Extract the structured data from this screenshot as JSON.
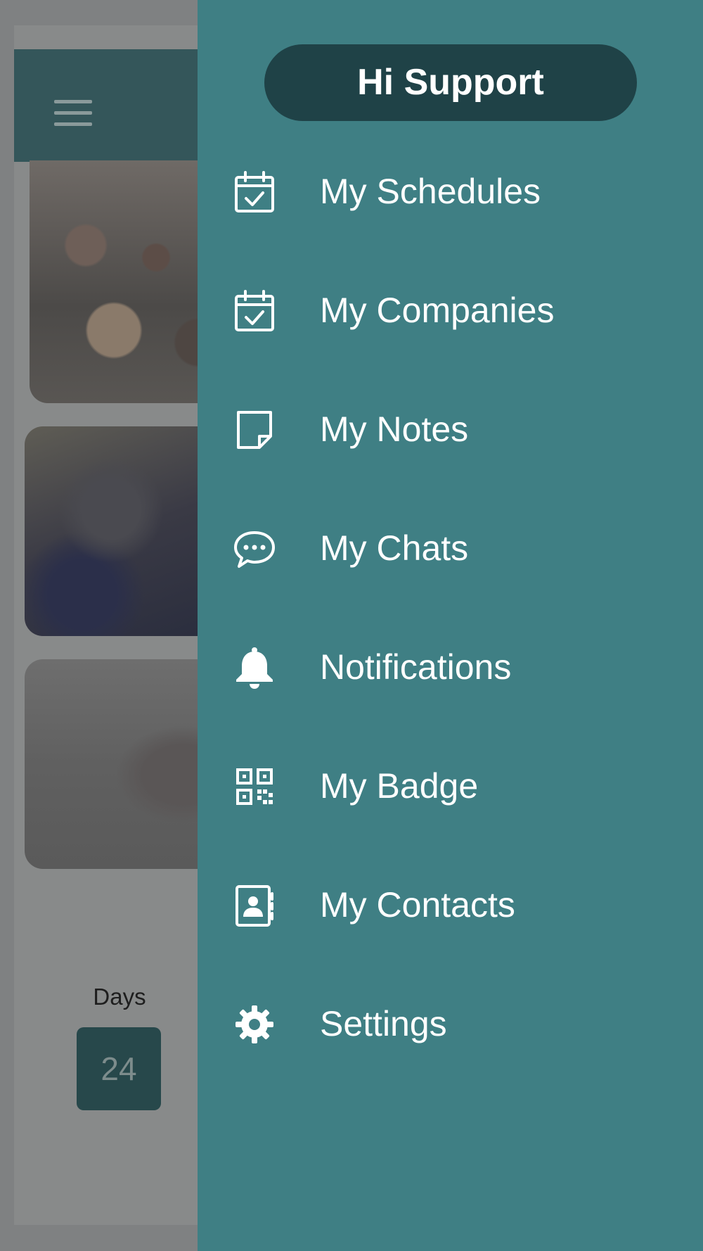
{
  "drawer": {
    "greeting": "Hi Support",
    "items": [
      {
        "label": "My Schedules",
        "icon": "calendar-check-icon"
      },
      {
        "label": "My Companies",
        "icon": "calendar-check-icon"
      },
      {
        "label": "My Notes",
        "icon": "sticky-note-icon"
      },
      {
        "label": "My Chats",
        "icon": "chat-bubble-icon"
      },
      {
        "label": "Notifications",
        "icon": "bell-icon"
      },
      {
        "label": "My Badge",
        "icon": "qr-code-icon"
      },
      {
        "label": "My Contacts",
        "icon": "contact-card-icon"
      },
      {
        "label": "Settings",
        "icon": "gear-icon"
      }
    ]
  },
  "background": {
    "countdown": {
      "days_label": "Days",
      "days_value": "24"
    }
  },
  "colors": {
    "drawer_bg": "#3f7f84",
    "greeting_pill_bg": "#1f4247",
    "header_bg": "#34565a",
    "text": "#ffffff"
  }
}
